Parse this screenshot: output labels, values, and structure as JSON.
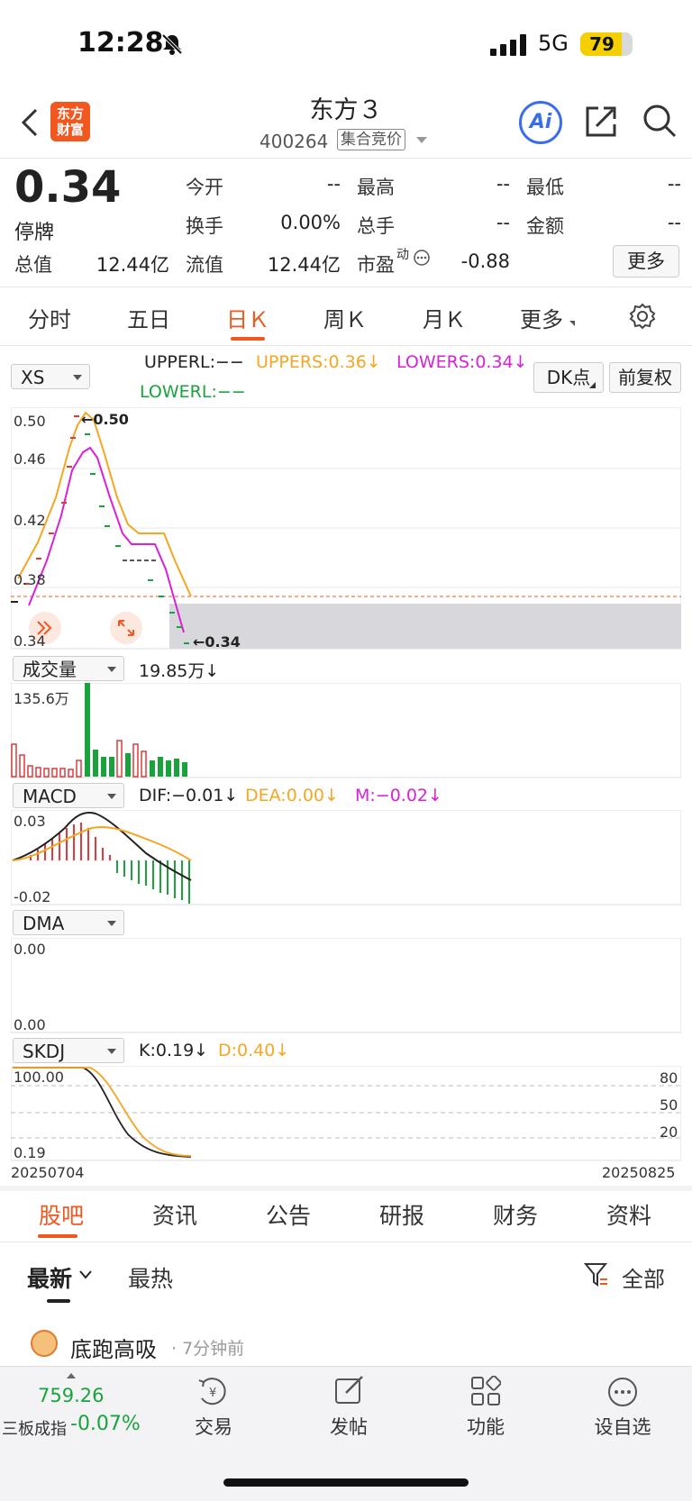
{
  "status": {
    "time": "12:28",
    "network": "5G",
    "battery": "79",
    "battery_level": 0.79
  },
  "header": {
    "logo_line1": "东方",
    "logo_line2": "财富",
    "name": "东方３",
    "code": "400264",
    "auction_tag": "集合竞价",
    "ai_label": "Ai"
  },
  "quote": {
    "price": "0.34",
    "status": "停牌",
    "open_label": "今开",
    "open": "--",
    "high_label": "最高",
    "high": "--",
    "low_label": "最低",
    "low": "--",
    "turnover_label": "换手",
    "turnover": "0.00%",
    "volume_label": "总手",
    "volume": "--",
    "amount_label": "金额",
    "amount": "--",
    "mcap_label": "总值",
    "mcap": "12.44亿",
    "float_label": "流值",
    "float": "12.44亿",
    "pe_label": "市盈",
    "pe_sup": "动",
    "pe": "-0.88",
    "more": "更多"
  },
  "ktabs": [
    "分时",
    "五日",
    "日Ｋ",
    "周Ｋ",
    "月Ｋ",
    "更多"
  ],
  "main_panel": {
    "selector": "XS",
    "upperl": "UPPERL:−−",
    "uppers": "UPPERS:0.36↓",
    "lowers": "LOWERS:0.34↓",
    "lowerl": "LOWERL:−−",
    "dk": "DK点",
    "adjust": "前复权",
    "y_labels": [
      "0.50",
      "0.46",
      "0.42",
      "0.38",
      "0.34"
    ],
    "max_mark": "←0.50",
    "min_mark": "←0.34"
  },
  "volume_panel": {
    "selector": "成交量",
    "value": "19.85万↓",
    "max_label": "135.6万"
  },
  "macd_panel": {
    "selector": "MACD",
    "dif": "DIF:−0.01↓",
    "dea": "DEA:0.00↓",
    "m": "M:−0.02↓",
    "top": "0.03",
    "bottom": "-0.02"
  },
  "dma_panel": {
    "selector": "DMA",
    "top": "0.00",
    "bottom": "0.00"
  },
  "skdj_panel": {
    "selector": "SKDJ",
    "k": "K:0.19↓",
    "d": "D:0.40↓",
    "top": "100.00",
    "bottom": "0.19",
    "levels": [
      "80",
      "50",
      "20"
    ],
    "start_date": "20250704",
    "end_date": "20250825"
  },
  "bottom_tabs": [
    "股吧",
    "资讯",
    "公告",
    "研报",
    "财务",
    "资料"
  ],
  "sort": {
    "latest": "最新",
    "hot": "最热",
    "filter": "全部"
  },
  "post": {
    "author": "底跑高吸",
    "time": "· 7分钟前"
  },
  "footer": {
    "index_value": "759.26",
    "index_name": "三板成指",
    "index_pct": "-0.07%",
    "trade": "交易",
    "post": "发帖",
    "func": "功能",
    "watch": "设自选"
  },
  "colors": {
    "accent": "#f2571f",
    "up": "#e03a3a",
    "down": "#1aa33c",
    "orange": "#f5a623",
    "magenta": "#d821d8"
  }
}
